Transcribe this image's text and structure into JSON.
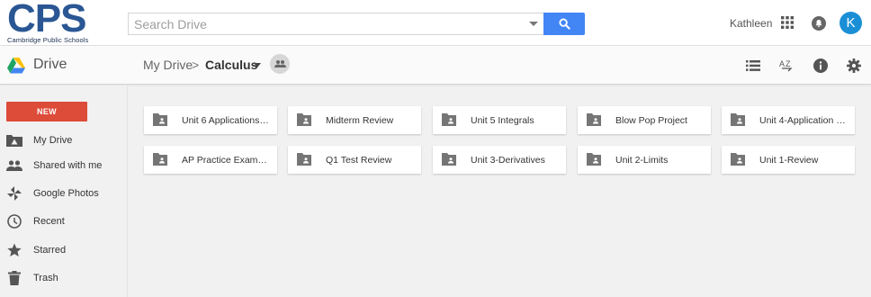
{
  "brand": {
    "logo_text": "CPS",
    "logo_subtitle": "Cambridge Public Schools"
  },
  "search": {
    "placeholder": "Search Drive",
    "value": ""
  },
  "user": {
    "name": "Kathleen",
    "avatar_initial": "K",
    "avatar_color": "#1a8fd6"
  },
  "drivebar": {
    "app_title": "Drive",
    "breadcrumb_root": "My Drive",
    "breadcrumb_separator": ">",
    "breadcrumb_current": "Calculus"
  },
  "sidebar": {
    "new_label": "NEW",
    "new_color": "#dd4b39",
    "items": [
      {
        "label": "My Drive",
        "icon": "my-drive-icon"
      },
      {
        "label": "Shared with me",
        "icon": "people-icon"
      },
      {
        "label": "Google Photos",
        "icon": "pinwheel-icon"
      },
      {
        "label": "Recent",
        "icon": "clock-icon"
      },
      {
        "label": "Starred",
        "icon": "star-icon"
      },
      {
        "label": "Trash",
        "icon": "trash-icon"
      }
    ]
  },
  "folders": [
    {
      "name": "Unit 6 Applications ..."
    },
    {
      "name": "Midterm Review"
    },
    {
      "name": "Unit 5 Integrals"
    },
    {
      "name": "Blow Pop Project"
    },
    {
      "name": "Unit 4-Application o..."
    },
    {
      "name": "AP Practice Exams-..."
    },
    {
      "name": "Q1 Test Review"
    },
    {
      "name": "Unit 3-Derivatives"
    },
    {
      "name": "Unit 2-Limits"
    },
    {
      "name": "Unit 1-Review"
    }
  ],
  "colors": {
    "accent": "#4285f4",
    "logo": "#2a5794"
  }
}
